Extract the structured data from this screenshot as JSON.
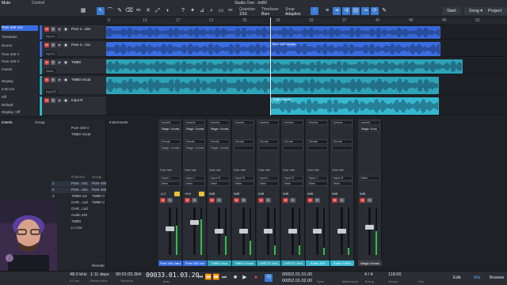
{
  "app": {
    "title": "Studio One - tmB0"
  },
  "toolbar": {
    "left_tab_mute": "Mute",
    "left_tab_control": "Control",
    "quantize_label": "Quantize",
    "quantize_value": "1/16",
    "timebase_label": "Timebase",
    "timebase_value": "Bars",
    "snap_label": "Snap",
    "snap_value": "Adaptive",
    "start_label": "Start",
    "song_label": "Song",
    "project_label": "Project"
  },
  "ruler": {
    "ticks": [
      "9",
      "13",
      "17",
      "21",
      "25",
      "29",
      "33",
      "37",
      "41",
      "45",
      "49",
      "53"
    ]
  },
  "inspector": {
    "track_name": "Pure 440 Voc",
    "rows": [
      "Timebase",
      "Drums",
      "Pure 440 V",
      "Pure 440 V",
      "Inserts",
      "Display",
      "0.00 ms",
      "Off",
      "Default",
      "Display: Off"
    ]
  },
  "tracks": [
    {
      "name": "Pure 4...uler",
      "input": "Input L",
      "color": "#3768d8",
      "clip_label": ""
    },
    {
      "name": "Pure 4...Voc",
      "input": "Input L",
      "color": "#3a6ee0",
      "clip_label": "Pure 440 Vocals"
    },
    {
      "name": "TMB0",
      "input": "None",
      "color": "#2ea3b8",
      "clip_label": ""
    },
    {
      "name": "TMB0 Vocal",
      "input": "Input R",
      "color": "#2ea3b8",
      "clip_label": ""
    },
    {
      "name": "Input R",
      "input": "",
      "color": "#35b8cf",
      "clip_label": "TMB0 Vocals"
    }
  ],
  "console": {
    "header_label": "Inserts",
    "instruments_label": "Instruments",
    "group_label": "Group",
    "channel_label": "Channel",
    "list": [
      "Pure 440 V",
      "TMB0 Vocal"
    ],
    "channel_rows": [
      {
        "num": "1",
        "name": "Pure...Voc",
        "group": "Pure 440"
      },
      {
        "num": "2",
        "name": "Pure...Voc",
        "group": "Pure 440"
      },
      {
        "num": "3",
        "name": "TMB0 voc",
        "group": "TMB0 V"
      },
      {
        "num": "4",
        "name": "CHR...cod",
        "group": "TMB0 V"
      },
      {
        "num": "5",
        "name": "CHR...cod",
        "group": ""
      },
      {
        "num": "6",
        "name": "Audio 440",
        "group": ""
      },
      {
        "num": "7",
        "name": "TMB0",
        "group": ""
      },
      {
        "num": "8",
        "name": "Lt core",
        "group": ""
      }
    ],
    "sends_label": "Sends",
    "remote_label": "Remote"
  },
  "strips": [
    {
      "name": "Pure 440 Jaku",
      "color": "#3768d8",
      "insert": "Inserts",
      "plugin": "Magic Vocals",
      "send": "Sends",
      "cue": "Cue mix",
      "input": "Input L",
      "output": "Main",
      "gain": "-4.3",
      "level": 0.55,
      "meter": 0.62
    },
    {
      "name": "Pure 440 Voc",
      "color": "#3a6ee0",
      "insert": "Inserts",
      "plugin": "Magic Vocals",
      "send": "Sends",
      "cue": "Cue mix",
      "input": "Input L",
      "output": "Main",
      "gain": "+6.6",
      "level": 0.7,
      "meter": 0.75
    },
    {
      "name": "TMB0 Voca",
      "color": "#2ea3b8",
      "insert": "Inserts",
      "plugin": "Magic Vocals",
      "send": "Sends",
      "cue": "Cue mix",
      "input": "Input R",
      "output": "Main",
      "gain": "0dB",
      "level": 0.5,
      "meter": 0.4
    },
    {
      "name": "TMB0 Vocals",
      "color": "#2ea3b8",
      "insert": "Inserts",
      "plugin": "",
      "send": "Sends",
      "cue": "Cue mix",
      "input": "Input R",
      "output": "Main",
      "gain": "0dB",
      "level": 0.5,
      "meter": 0.3
    },
    {
      "name": "CHR(TD 440)",
      "color": "#2ea3b8",
      "insert": "Inserts",
      "plugin": "",
      "send": "Sends",
      "cue": "Cue mix",
      "input": "Input L",
      "output": "Main",
      "gain": "0dB",
      "level": 0.5,
      "meter": 0.2
    },
    {
      "name": "CHR(TD 440)",
      "color": "#2ea3b8",
      "insert": "Inserts",
      "plugin": "",
      "send": "Sends",
      "cue": "Cue mix",
      "input": "Input R",
      "output": "Main",
      "gain": "0dB",
      "level": 0.5,
      "meter": 0.2
    },
    {
      "name": "Audio 440",
      "color": "#35b8cf",
      "insert": "Inserts",
      "plugin": "",
      "send": "Sends",
      "cue": "Cue mix",
      "input": "Input L",
      "output": "Main",
      "gain": "0dB",
      "level": 0.5,
      "meter": 0.15
    },
    {
      "name": "Audio TMB0",
      "color": "#35b8cf",
      "insert": "Inserts",
      "plugin": "",
      "send": "Sends",
      "cue": "Cue mix",
      "input": "Input R",
      "output": "Main",
      "gain": "0dB",
      "level": 0.5,
      "meter": 0.15
    },
    {
      "name": "Magic Vocals",
      "color": "#3a3e45",
      "insert": "Inserts",
      "plugin": "Magic Voca",
      "send": "",
      "cue": "",
      "input": "Main",
      "output": "",
      "gain": "0dB",
      "level": 0.6,
      "meter": 0.5
    }
  ],
  "status": {
    "sample_rate": "48.0 kHz",
    "sample_rate_sub": "0.0 ms",
    "record_max": "1:11 days",
    "record_max_lbl": "Record Max",
    "seconds": "00:01:05.364",
    "seconds_lbl": "Seconds",
    "position": "00033.01.03.20",
    "position_lbl": "Bars",
    "loop_start": "00002.01.01.00",
    "loop_end": "00052.01.02.00",
    "sync_lbl": "Sync",
    "metronome_lbl": "Metronome",
    "timing": "4 / 4",
    "timing_lbl": "Timing",
    "tempo": "118.00",
    "tempo_lbl": "Tempo",
    "key_lbl": "Key",
    "edit_label": "Edit",
    "mix_label": "Mix",
    "browse_label": "Browse"
  }
}
